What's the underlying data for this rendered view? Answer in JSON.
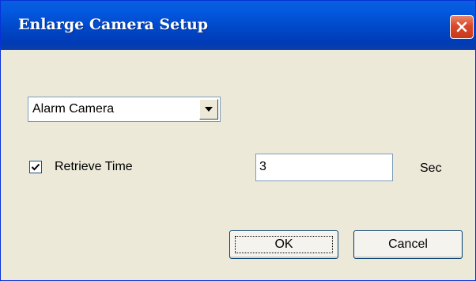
{
  "window": {
    "title": "Enlarge Camera Setup"
  },
  "camera_select": {
    "selected": "Alarm Camera"
  },
  "retrieve": {
    "checkbox_label": "Retrieve Time",
    "checked": true,
    "value": "3",
    "unit": "Sec"
  },
  "buttons": {
    "ok": "OK",
    "cancel": "Cancel"
  },
  "icons": [
    "close-icon",
    "chevron-down-icon",
    "checkmark-icon"
  ],
  "colors": {
    "titlebar": "#0048c8",
    "close_button": "#d9482b",
    "dialog_background": "#ece9d8"
  }
}
